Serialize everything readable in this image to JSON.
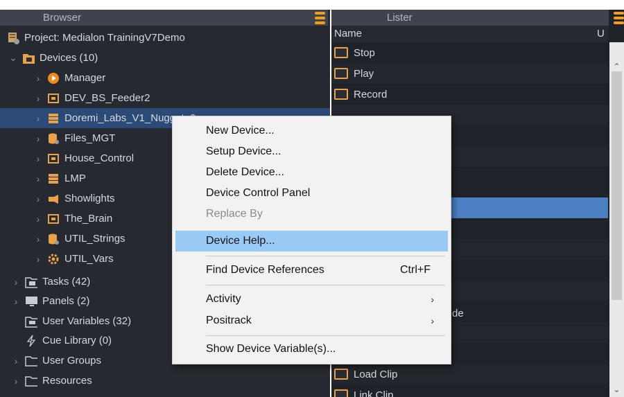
{
  "browser": {
    "title": "Browser",
    "project": "Project: Medialon TrainingV7Demo",
    "devices_label": "Devices (10)",
    "devices": [
      {
        "label": "Manager",
        "icon": "play-circle-icon"
      },
      {
        "label": "DEV_BS_Feeder2",
        "icon": "device-box-icon"
      },
      {
        "label": "Doremi_Labs_V1_Nugget_0",
        "icon": "server-stack-icon"
      },
      {
        "label": "Files_MGT",
        "icon": "database-icon"
      },
      {
        "label": "House_Control",
        "icon": "device-box-icon"
      },
      {
        "label": "LMP",
        "icon": "server-stack-icon"
      },
      {
        "label": "Showlights",
        "icon": "spotlight-icon"
      },
      {
        "label": "The_Brain",
        "icon": "device-box-icon"
      },
      {
        "label": "UTIL_Strings",
        "icon": "database-icon"
      },
      {
        "label": "UTIL_Vars",
        "icon": "gear-icon"
      }
    ],
    "sections": [
      {
        "label": "Tasks (42)",
        "icon": "tasks-folder-icon"
      },
      {
        "label": "Panels (2)",
        "icon": "monitor-icon"
      },
      {
        "label": "User Variables (32)",
        "icon": "variables-folder-icon"
      },
      {
        "label": "Cue Library (0)",
        "icon": "lightning-icon"
      },
      {
        "label": "User Groups",
        "icon": "folder-icon"
      },
      {
        "label": "Resources",
        "icon": "folder-icon"
      }
    ]
  },
  "lister": {
    "title": "Lister",
    "col_name": "Name",
    "col_u": "U",
    "rows": [
      "Stop",
      "Play",
      "Record",
      "",
      "",
      "",
      "",
      "",
      "",
      "",
      "",
      "",
      "",
      "",
      "Load Clip",
      "Link Clip"
    ],
    "peek_text": "de"
  },
  "context_menu": {
    "items": [
      {
        "label": "New Device..."
      },
      {
        "label": "Setup Device..."
      },
      {
        "label": "Delete Device..."
      },
      {
        "label": "Device Control Panel"
      },
      {
        "label": "Replace By"
      },
      {
        "label": "Device Help..."
      },
      {
        "label": "Find Device References",
        "shortcut": "Ctrl+F"
      },
      {
        "label": "Activity"
      },
      {
        "label": "Positrack"
      },
      {
        "label": "Show Device Variable(s)..."
      }
    ]
  },
  "colors": {
    "accent": "#f0a020",
    "selection": "#2c4a78",
    "menu_hover": "#99c9f5"
  }
}
